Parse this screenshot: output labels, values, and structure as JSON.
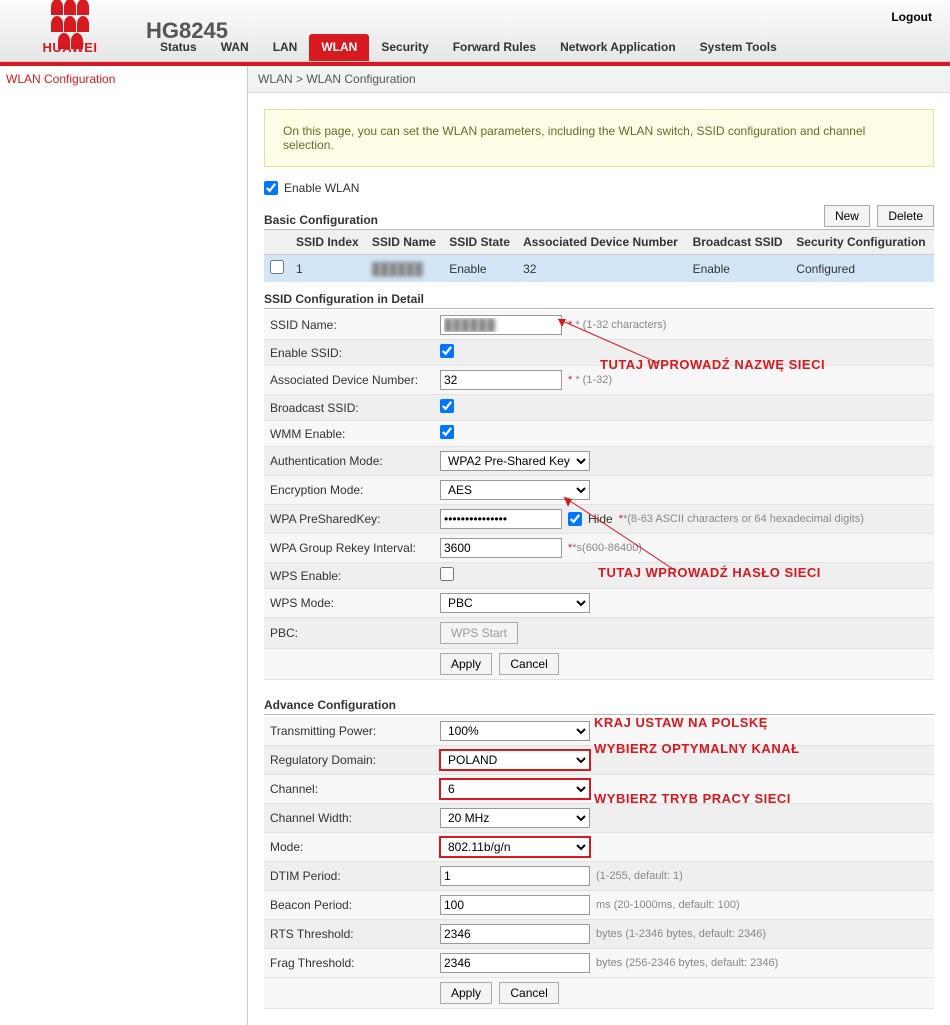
{
  "header": {
    "model": "HG8245",
    "logout": "Logout",
    "brand": "HUAWEI"
  },
  "nav": [
    "Status",
    "WAN",
    "LAN",
    "WLAN",
    "Security",
    "Forward Rules",
    "Network Application",
    "System Tools"
  ],
  "nav_active": 3,
  "sidebar": {
    "items": [
      "WLAN Configuration"
    ]
  },
  "crumb": "WLAN > WLAN Configuration",
  "info": "On this page, you can set the WLAN parameters, including the WLAN switch, SSID configuration and channel selection.",
  "enable_wlan_label": "Enable WLAN",
  "basic": {
    "title": "Basic Configuration",
    "new": "New",
    "delete": "Delete",
    "cols": [
      "SSID Index",
      "SSID Name",
      "SSID State",
      "Associated Device Number",
      "Broadcast SSID",
      "Security Configuration"
    ],
    "rows": [
      {
        "index": "1",
        "name": "██████",
        "state": "Enable",
        "assoc": "32",
        "broadcast": "Enable",
        "security": "Configured"
      }
    ]
  },
  "detail": {
    "title": "SSID Configuration in Detail",
    "ssid_name_label": "SSID Name:",
    "ssid_name_value": "██████",
    "ssid_name_hint": "* (1-32 characters)",
    "enable_ssid_label": "Enable SSID:",
    "assoc_label": "Associated Device Number:",
    "assoc_value": "32",
    "assoc_hint": "* (1-32)",
    "broadcast_label": "Broadcast SSID:",
    "wmm_label": "WMM Enable:",
    "auth_label": "Authentication Mode:",
    "auth_value": "WPA2 Pre-Shared Key",
    "enc_label": "Encryption Mode:",
    "enc_value": "AES",
    "psk_label": "WPA PreSharedKey:",
    "psk_value": "●●●●●●●●●●●●●●●",
    "hide_label": "Hide",
    "psk_hint": "*(8-63 ASCII characters or 64 hexadecimal digits)",
    "rekey_label": "WPA Group Rekey Interval:",
    "rekey_value": "3600",
    "rekey_hint": "*s(600-86400)",
    "wps_enable_label": "WPS Enable:",
    "wps_mode_label": "WPS Mode:",
    "wps_mode_value": "PBC",
    "pbc_label": "PBC:",
    "wps_start": "WPS Start",
    "apply": "Apply",
    "cancel": "Cancel"
  },
  "advance": {
    "title": "Advance Configuration",
    "tx_label": "Transmitting Power:",
    "tx_value": "100%",
    "reg_label": "Regulatory Domain:",
    "reg_value": "POLAND",
    "chan_label": "Channel:",
    "chan_value": "6",
    "cw_label": "Channel Width:",
    "cw_value": "20 MHz",
    "mode_label": "Mode:",
    "mode_value": "802.11b/g/n",
    "dtim_label": "DTIM Period:",
    "dtim_value": "1",
    "dtim_hint": "(1-255, default: 1)",
    "beacon_label": "Beacon Period:",
    "beacon_value": "100",
    "beacon_hint": "ms (20-1000ms, default: 100)",
    "rts_label": "RTS Threshold:",
    "rts_value": "2346",
    "rts_hint": "bytes (1-2346 bytes, default: 2346)",
    "frag_label": "Frag Threshold:",
    "frag_value": "2346",
    "frag_hint": "bytes (256-2346 bytes, default: 2346)",
    "apply": "Apply",
    "cancel": "Cancel"
  },
  "annotations": {
    "ssid": "TUTAJ WPROWADŹ NAZWĘ SIECI",
    "psk": "TUTAJ WPROWADŹ HASŁO SIECI",
    "reg": "KRAJ USTAW NA POLSKĘ",
    "chan": "WYBIERZ OPTYMALNY KANAŁ",
    "mode": "WYBIERZ TRYB PRACY SIECI"
  }
}
